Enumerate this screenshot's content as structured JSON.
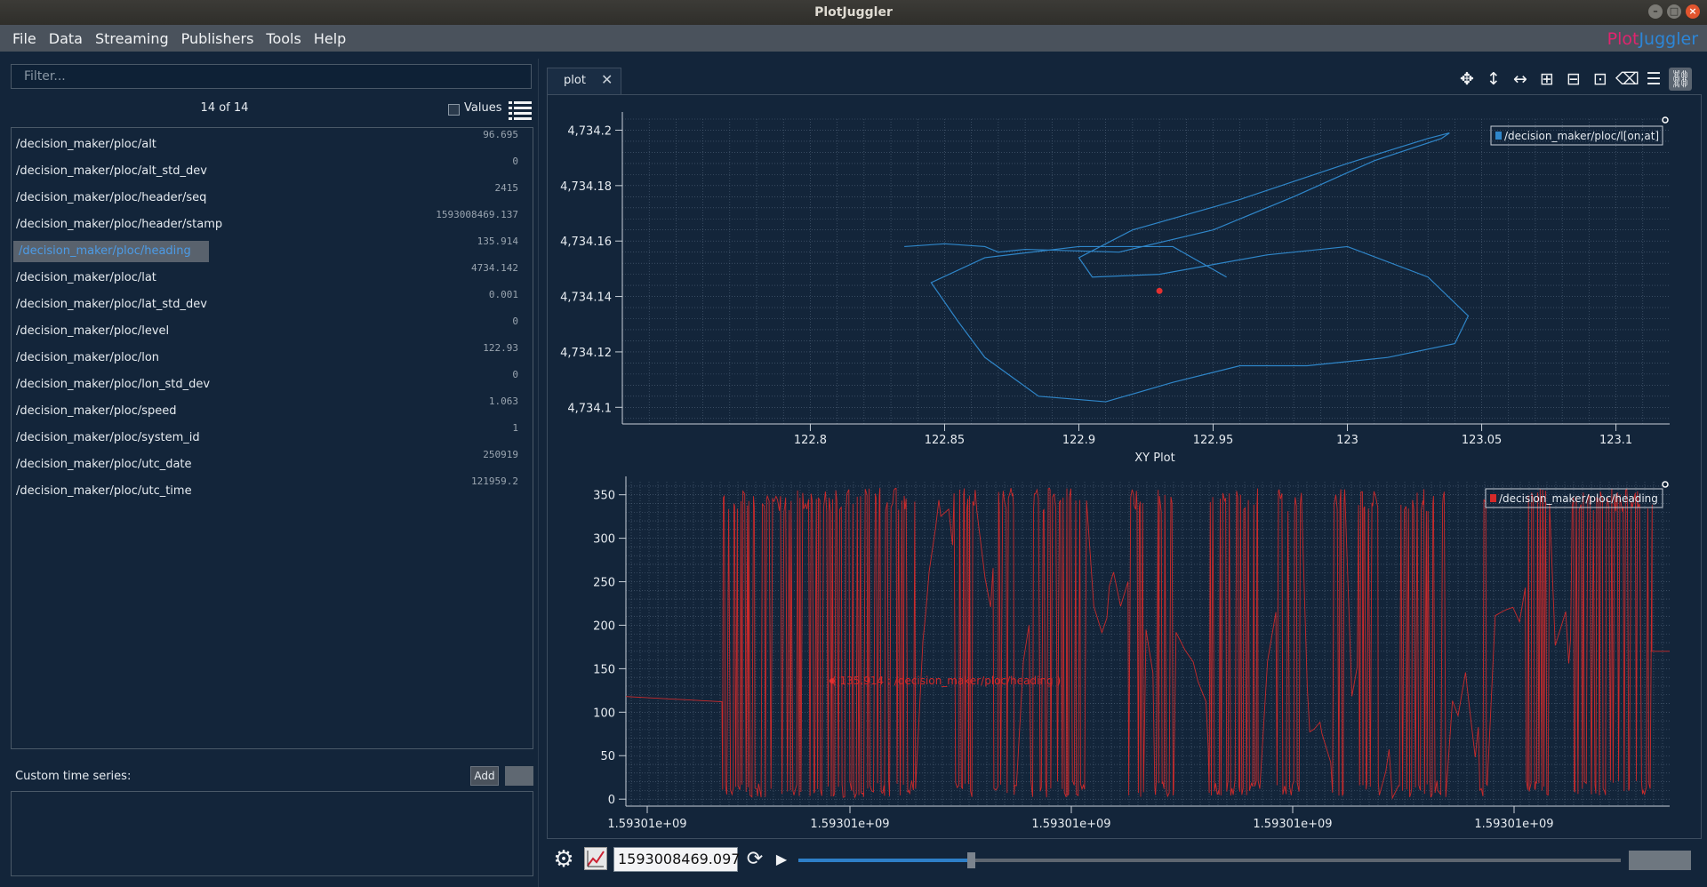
{
  "window": {
    "title": "PlotJuggler"
  },
  "menu": {
    "items": [
      "File",
      "Data",
      "Streaming",
      "Publishers",
      "Tools",
      "Help"
    ]
  },
  "logo": {
    "part1": "Plot",
    "part2": "Juggler"
  },
  "left_panel": {
    "filter_placeholder": "Filter...",
    "count": "14 of 14",
    "values_label": "Values",
    "rows": [
      {
        "name": "/decision_maker/ploc/alt",
        "value": "96.695"
      },
      {
        "name": "/decision_maker/ploc/alt_std_dev",
        "value": "0"
      },
      {
        "name": "/decision_maker/ploc/header/seq",
        "value": "2415"
      },
      {
        "name": "/decision_maker/ploc/header/stamp",
        "value": "1593008469.137"
      },
      {
        "name": "/decision_maker/ploc/heading",
        "value": "135.914",
        "selected": true
      },
      {
        "name": "/decision_maker/ploc/lat",
        "value": "4734.142"
      },
      {
        "name": "/decision_maker/ploc/lat_std_dev",
        "value": "0.001"
      },
      {
        "name": "/decision_maker/ploc/level",
        "value": "0"
      },
      {
        "name": "/decision_maker/ploc/lon",
        "value": "122.93"
      },
      {
        "name": "/decision_maker/ploc/lon_std_dev",
        "value": "0"
      },
      {
        "name": "/decision_maker/ploc/speed",
        "value": "1.063"
      },
      {
        "name": "/decision_maker/ploc/system_id",
        "value": "1"
      },
      {
        "name": "/decision_maker/ploc/utc_date",
        "value": "250919"
      },
      {
        "name": "/decision_maker/ploc/utc_time",
        "value": "121959.2"
      }
    ],
    "custom_label": "Custom time series:",
    "add_label": "Add"
  },
  "tab": {
    "label": "plot"
  },
  "toolbar": {
    "icons": [
      "move-icon",
      "zoom-vertical-icon",
      "zoom-horizontal-icon",
      "split-vertical-icon",
      "add-row-icon",
      "add-column-icon",
      "clear-icon",
      "legend-icon",
      "link-icon"
    ]
  },
  "colors": {
    "xy_series": "#2f86c9",
    "heading_series": "#d42a2a",
    "accent": "#2e7fc8"
  },
  "chart_data": [
    {
      "type": "line",
      "xlabel": "XY Plot",
      "legend": "/decision_maker/ploc/l[on;at]",
      "legend_position": "top-right",
      "grid": true,
      "xlim": [
        122.73,
        123.12
      ],
      "ylim": [
        4734.094,
        4734.204
      ],
      "x_ticks": [
        "122.8",
        "122.85",
        "122.9",
        "122.95",
        "123",
        "123.05",
        "123.1"
      ],
      "y_ticks": [
        "4,734.1",
        "4,734.12",
        "4,734.14",
        "4,734.16",
        "4,734.18",
        "4,734.2"
      ],
      "series": [
        {
          "name": "/decision_maker/ploc/l[on;at]",
          "x": [
            122.835,
            122.85,
            122.865,
            122.87,
            122.88,
            122.915,
            122.95,
            122.98,
            123.01,
            123.035,
            123.038,
            123.03,
            123.0,
            122.96,
            122.92,
            122.9,
            122.905,
            122.93,
            122.97,
            123.0,
            123.03,
            123.045,
            123.04,
            123.015,
            122.985,
            122.96,
            122.935,
            122.91,
            122.885,
            122.865,
            122.855,
            122.845,
            122.865,
            122.9,
            122.935,
            122.955
          ],
          "y": [
            4734.158,
            4734.159,
            4734.158,
            4734.156,
            4734.157,
            4734.156,
            4734.164,
            4734.176,
            4734.189,
            4734.197,
            4734.199,
            4734.197,
            4734.188,
            4734.175,
            4734.164,
            4734.154,
            4734.147,
            4734.148,
            4734.155,
            4734.158,
            4734.147,
            4734.133,
            4734.123,
            4734.118,
            4734.115,
            4734.115,
            4734.109,
            4734.102,
            4734.104,
            4734.118,
            4734.131,
            4734.145,
            4734.154,
            4734.158,
            4734.158,
            4734.147
          ]
        }
      ],
      "marker": {
        "x": 122.93,
        "y": 4734.142
      }
    },
    {
      "type": "line",
      "legend": "/decision_maker/ploc/heading",
      "legend_position": "top-right",
      "grid": true,
      "ylim": [
        -8,
        365
      ],
      "y_ticks": [
        "0",
        "50",
        "100",
        "150",
        "200",
        "250",
        "300",
        "350"
      ],
      "x_ticks": [
        "1.59301e+09",
        "1.59301e+09",
        "1.59301e+09",
        "1.59301e+09",
        "1.59301e+09"
      ],
      "annotation": "( 135.914 : /decision_maker/ploc/heading )",
      "series": [
        {
          "name": "/decision_maker/ploc/heading",
          "note": "dense oscillating signal between 0 and 360, flat ~118 at the start"
        }
      ]
    }
  ],
  "bottom": {
    "time_value": "1593008469.097",
    "slider_fraction": 0.21
  }
}
